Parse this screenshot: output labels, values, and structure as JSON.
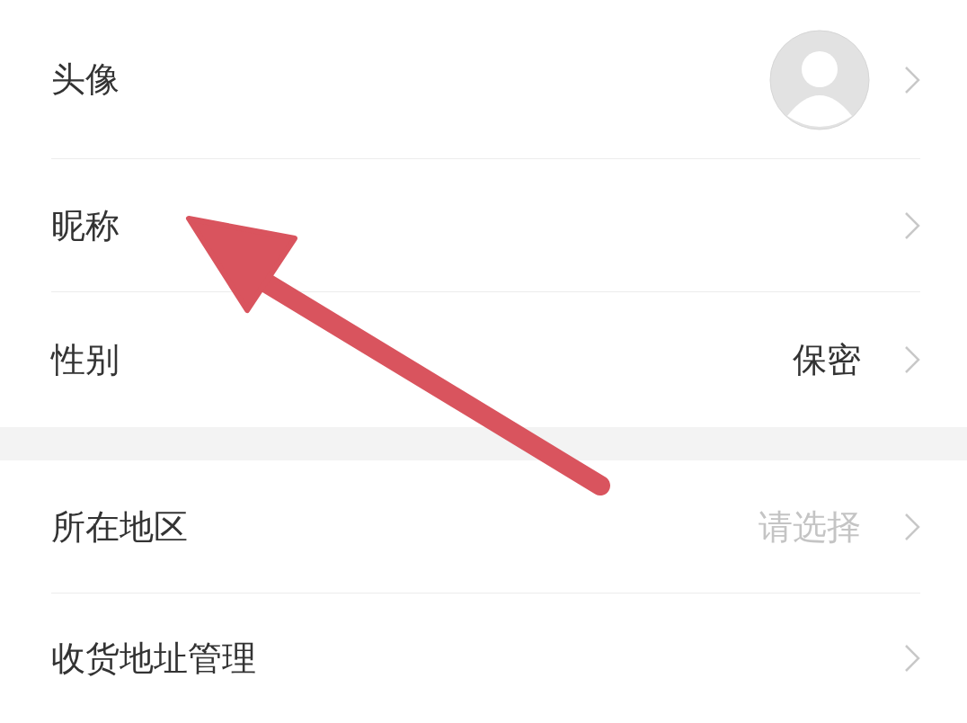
{
  "sections": [
    {
      "rows": [
        {
          "kind": "avatar",
          "label": "头像"
        },
        {
          "kind": "plain",
          "label": "昵称"
        },
        {
          "kind": "value",
          "label": "性别",
          "value": "保密"
        }
      ]
    },
    {
      "rows": [
        {
          "kind": "placeholder",
          "label": "所在地区",
          "placeholder": "请选择"
        },
        {
          "kind": "plain",
          "label": "收货地址管理"
        }
      ]
    }
  ],
  "annotation": {
    "kind": "arrow"
  }
}
